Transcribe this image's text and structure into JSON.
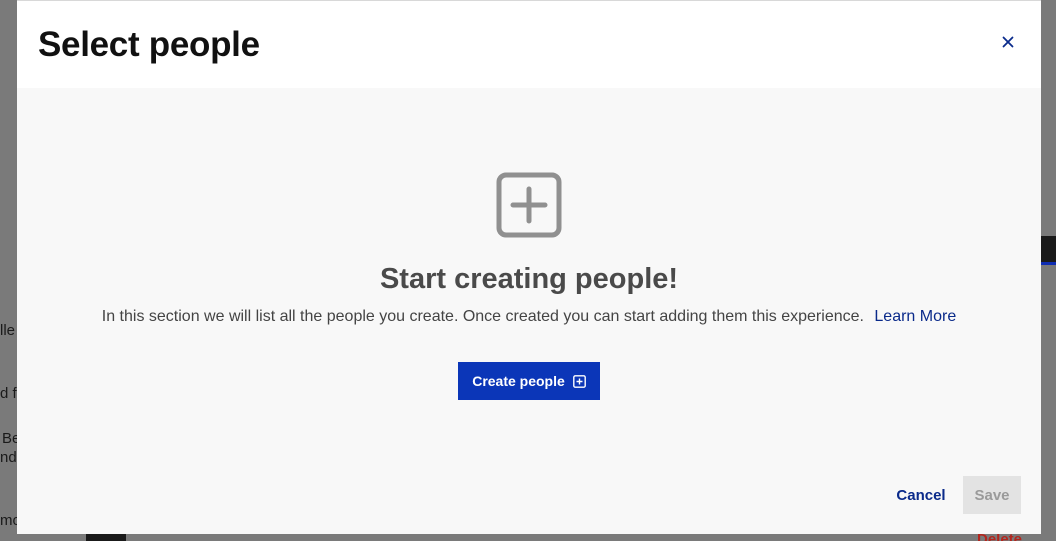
{
  "background": {
    "fragments": [
      "lle",
      "d fo",
      "Be",
      "nd",
      "mo"
    ],
    "delete_label": "Delete"
  },
  "modal": {
    "title": "Select people",
    "close_icon": "close-icon",
    "empty_state": {
      "icon": "plus-square-icon",
      "title": "Start creating people!",
      "description": "In this section we will list all the people you create. Once created you can start adding them this experience.",
      "learn_more": "Learn More"
    },
    "create_button": {
      "label": "Create people",
      "icon": "plus-square-icon"
    },
    "footer": {
      "cancel_label": "Cancel",
      "save_label": "Save"
    }
  },
  "colors": {
    "primary": "#0b36b8",
    "link": "#0a2a8a",
    "title_gray": "#4a4a4a",
    "disabled_bg": "#e3e3e3",
    "disabled_text": "#9a9a9a"
  }
}
